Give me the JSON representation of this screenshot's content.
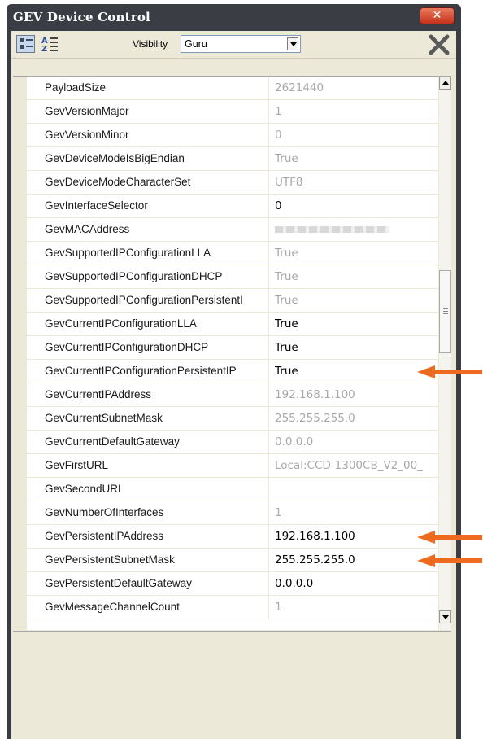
{
  "window": {
    "title": "GEV Device Control",
    "close_glyph": "✕"
  },
  "toolbar": {
    "categorized_icon": "categorized-view-icon",
    "alpha_icon": "alphabetical-sort-icon",
    "visibility_label": "Visibility",
    "visibility_value": "Guru",
    "close_tool_icon": "x-close-icon"
  },
  "properties": [
    {
      "name": "PayloadSize",
      "value": "2621440",
      "readonly": true
    },
    {
      "name": "GevVersionMajor",
      "value": "1",
      "readonly": true
    },
    {
      "name": "GevVersionMinor",
      "value": "0",
      "readonly": true
    },
    {
      "name": "GevDeviceModeIsBigEndian",
      "value": "True",
      "readonly": true
    },
    {
      "name": "GevDeviceModeCharacterSet",
      "value": "UTF8",
      "readonly": true
    },
    {
      "name": "GevInterfaceSelector",
      "value": "0",
      "readonly": false
    },
    {
      "name": "GevMACAddress",
      "value": "",
      "readonly": true,
      "redacted": true
    },
    {
      "name": "GevSupportedIPConfigurationLLA",
      "value": "True",
      "readonly": true
    },
    {
      "name": "GevSupportedIPConfigurationDHCP",
      "value": "True",
      "readonly": true
    },
    {
      "name": "GevSupportedIPConfigurationPersistentI",
      "value": "True",
      "readonly": true
    },
    {
      "name": "GevCurrentIPConfigurationLLA",
      "value": "True",
      "readonly": false
    },
    {
      "name": "GevCurrentIPConfigurationDHCP",
      "value": "True",
      "readonly": false
    },
    {
      "name": "GevCurrentIPConfigurationPersistentIP",
      "value": "True",
      "readonly": false,
      "highlighted": true
    },
    {
      "name": "GevCurrentIPAddress",
      "value": "192.168.1.100",
      "readonly": true
    },
    {
      "name": "GevCurrentSubnetMask",
      "value": "255.255.255.0",
      "readonly": true
    },
    {
      "name": "GevCurrentDefaultGateway",
      "value": "0.0.0.0",
      "readonly": true
    },
    {
      "name": "GevFirstURL",
      "value": "Local:CCD-1300CB_V2_00_",
      "readonly": true
    },
    {
      "name": "GevSecondURL",
      "value": "",
      "readonly": true
    },
    {
      "name": "GevNumberOfInterfaces",
      "value": "1",
      "readonly": true
    },
    {
      "name": "GevPersistentIPAddress",
      "value": "192.168.1.100",
      "readonly": false,
      "highlighted": true
    },
    {
      "name": "GevPersistentSubnetMask",
      "value": "255.255.255.0",
      "readonly": false,
      "highlighted": true
    },
    {
      "name": "GevPersistentDefaultGateway",
      "value": "0.0.0.0",
      "readonly": false
    },
    {
      "name": "GevMessageChannelCount",
      "value": "1",
      "readonly": true
    }
  ],
  "colors": {
    "title_bar": "#3a3d43",
    "panel": "#ece9d8",
    "readonly_text": "#a9a9a9",
    "editable_text": "#000000",
    "annotation_arrow": "#ee6a1f",
    "close_button": "#c4321a"
  }
}
